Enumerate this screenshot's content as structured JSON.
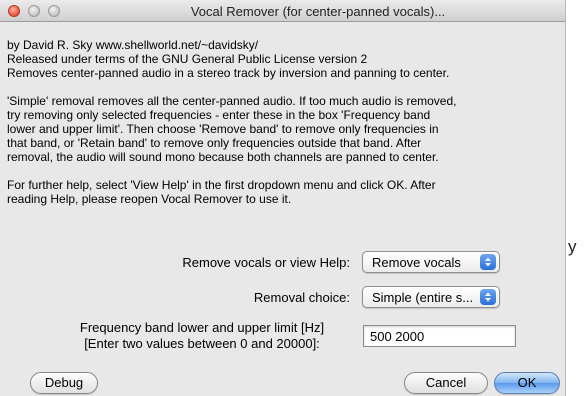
{
  "window": {
    "title": "Vocal Remover (for center-panned vocals)..."
  },
  "stray_text": "y",
  "description": {
    "intro": [
      "by David R. Sky www.shellworld.net/~davidsky/",
      "Released under terms of the GNU General Public License version 2",
      "Removes center-panned audio in a stereo track by inversion and panning to center."
    ],
    "simple": [
      "'Simple' removal removes all the center-panned audio. If too much audio is removed,",
      "try removing only selected frequencies - enter these in the box 'Frequency band",
      "lower and upper limit'. Then choose 'Remove band' to remove only frequencies in",
      "that band, or 'Retain band' to remove only frequencies outside that band. After",
      "removal, the audio will sound mono because both channels are panned to center."
    ],
    "help": [
      "For further help, select 'View Help' in the first dropdown menu and click OK. After",
      "reading Help, please reopen Vocal Remover to use it."
    ]
  },
  "controls": {
    "remove_label": "Remove vocals or view Help:",
    "remove_value": "Remove vocals",
    "choice_label": "Removal choice:",
    "choice_value": "Simple (entire s...",
    "freq_label_line1": "Frequency band lower and upper limit [Hz]",
    "freq_label_line2": "[Enter two values between 0 and 20000]:",
    "freq_value": "500 2000"
  },
  "buttons": {
    "debug": "Debug",
    "cancel": "Cancel",
    "ok": "OK"
  },
  "icons": {
    "select_arrows": "updown-arrows-icon"
  },
  "colors": {
    "accent": "#2a6fd6",
    "window_bg": "#e8e8e8"
  }
}
